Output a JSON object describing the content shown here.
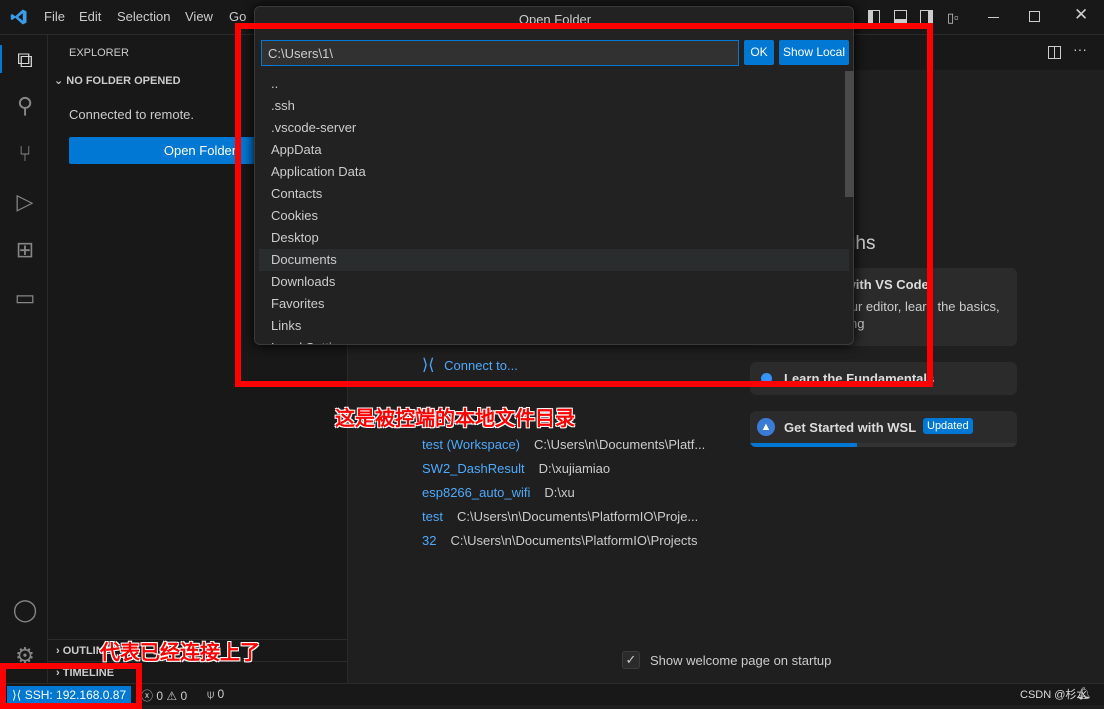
{
  "menu": {
    "items": [
      "File",
      "Edit",
      "Selection",
      "View",
      "Go"
    ]
  },
  "sidebar": {
    "title": "EXPLORER",
    "section": "NO FOLDER OPENED",
    "message": "Connected to remote.",
    "open_folder": "Open Folder",
    "outline": "OUTLINE",
    "timeline": "TIMELINE"
  },
  "quickpick": {
    "title": "Open Folder",
    "input_value": "C:\\Users\\1\\",
    "ok": "OK",
    "show_local": "Show Local",
    "items": [
      "..",
      ".ssh",
      ".vscode-server",
      "AppData",
      "Application Data",
      "Contacts",
      "Cookies",
      "Desktop",
      "Documents",
      "Downloads",
      "Favorites",
      "Links",
      "Local Settings"
    ],
    "selected": "Documents"
  },
  "welcome": {
    "connect": "Connect to...",
    "walkthroughs": "Walkthroughs",
    "cards": [
      {
        "title": "Get Started with VS Code",
        "desc": "Customize your editor, learn the basics, and start coding"
      },
      {
        "title": "Learn the Fundamentals"
      },
      {
        "title": "Get Started with WSL",
        "badge": "Updated",
        "progress": 0.4
      }
    ],
    "recent": [
      {
        "name": "test (Workspace)",
        "path": "C:\\Users\\n\\Documents\\Platf..."
      },
      {
        "name": "SW2_DashResult",
        "path": "D:\\xujiamiao"
      },
      {
        "name": "esp8266_auto_wifi",
        "path": "D:\\xu"
      },
      {
        "name": "test",
        "path": "C:\\Users\\n\\Documents\\PlatformIO\\Proje..."
      },
      {
        "name": "32",
        "path": "C:\\Users\\n\\Documents\\PlatformIO\\Projects"
      }
    ],
    "show_on_startup": "Show welcome page on startup",
    "show_on_startup_checked": true
  },
  "status": {
    "remote": "SSH: 192.168.0.87",
    "errors": "0",
    "warnings": "0",
    "ports": "0"
  },
  "annotations": {
    "dialog": "这是被控端的本地文件目录",
    "status": "代表已经连接上了"
  },
  "watermark": "CSDN @杉水",
  "colors": {
    "accent": "#0078d4",
    "annotation": "#ff0000"
  }
}
